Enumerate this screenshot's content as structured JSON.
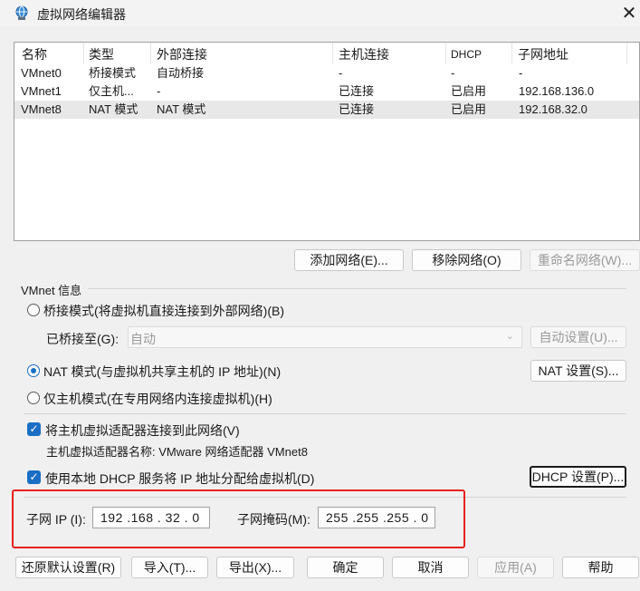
{
  "window": {
    "title": "虚拟网络编辑器",
    "close_glyph": "✕"
  },
  "network_list": {
    "columns": [
      "名称",
      "类型",
      "外部连接",
      "主机连接",
      "DHCP",
      "子网地址"
    ],
    "rows": [
      [
        "VMnet0",
        "桥接模式",
        "自动桥接",
        "-",
        "-",
        "-"
      ],
      [
        "VMnet1",
        "仅主机...",
        "-",
        "已连接",
        "已启用",
        "192.168.136.0"
      ],
      [
        "VMnet8",
        "NAT 模式",
        "NAT 模式",
        "已连接",
        "已启用",
        "192.168.32.0"
      ]
    ],
    "selected_row": 2
  },
  "list_buttons": {
    "add": "添加网络(E)...",
    "remove": "移除网络(O)",
    "rename": "重命名网络(W)..."
  },
  "vmnet_info": {
    "group_label": "VMnet 信息",
    "bridged_radio": "桥接模式(将虚拟机直接连接到外部网络)(B)",
    "bridged_to_label": "已桥接至(G):",
    "bridged_to_value": "自动",
    "auto_settings": "自动设置(U)...",
    "nat_radio": "NAT 模式(与虚拟机共享主机的 IP 地址)(N)",
    "nat_settings": "NAT 设置(S)...",
    "host_only_radio": "仅主机模式(在专用网络内连接虚拟机)(H)",
    "selected_mode": "nat",
    "connect_adapter_check": "将主机虚拟适配器连接到此网络(V)",
    "connect_adapter_checked": true,
    "adapter_name_label": "主机虚拟适配器名称: VMware 网络适配器 VMnet8",
    "dhcp_check": "使用本地 DHCP 服务将 IP 地址分配给虚拟机(D)",
    "dhcp_checked": true,
    "dhcp_settings": "DHCP 设置(P)...",
    "subnet_ip_label": "子网 IP (I):",
    "subnet_ip_value": "192 .168 . 32  .  0",
    "subnet_mask_label": "子网掩码(M):",
    "subnet_mask_value": "255 .255 .255 .  0"
  },
  "footer_buttons": {
    "restore": "还原默认设置(R)",
    "import": "导入(T)...",
    "export": "导出(X)...",
    "ok": "确定",
    "cancel": "取消",
    "apply": "应用(A)",
    "help": "帮助"
  },
  "colors": {
    "accent": "#1a6fc4",
    "highlight_box": "#e8211f",
    "selected_row": "#e8e8e8"
  }
}
